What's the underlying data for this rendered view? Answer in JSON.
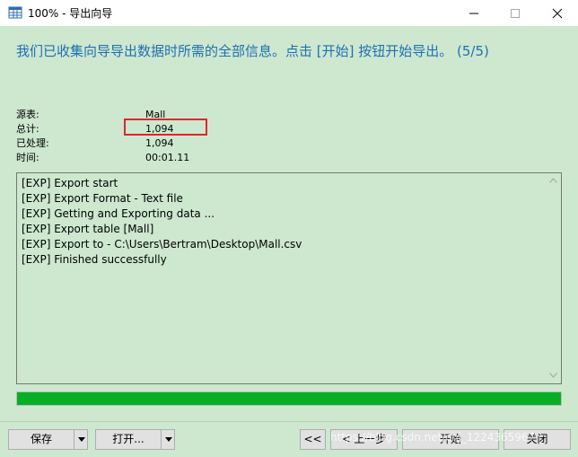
{
  "window": {
    "title": "100% - 导出向导"
  },
  "heading": "我们已收集向导导出数据时所需的全部信息。点击 [开始] 按钮开始导出。 (5/5)",
  "info": {
    "source_label": "源表:",
    "source_value": "Mall",
    "total_label": "总计:",
    "total_value": "1,094",
    "processed_label": "已处理:",
    "processed_value": "1,094",
    "time_label": "时间:",
    "time_value": "00:01.11"
  },
  "log": [
    "[EXP] Export start",
    "[EXP] Export Format - Text file",
    "[EXP] Getting and Exporting data ...",
    "[EXP] Export table [Mall]",
    "[EXP] Export to - C:\\Users\\Bertram\\Desktop\\Mall.csv",
    "[EXP] Finished successfully"
  ],
  "progress": {
    "percent": 100
  },
  "buttons": {
    "save": "保存",
    "open": "打开...",
    "first": "<<",
    "prev": "< 上一步",
    "start": "开始",
    "close": "关闭"
  },
  "watermark": "https://blog.csdn.net/chj_1224365967",
  "colors": {
    "heading": "#1f6fb3",
    "background": "#cde8cf",
    "progress": "#06b025",
    "highlight": "#e3242b"
  }
}
